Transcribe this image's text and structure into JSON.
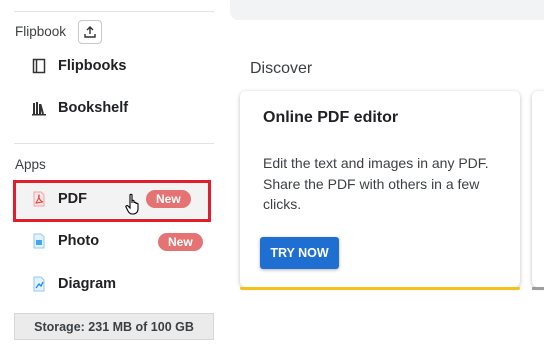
{
  "sidebar": {
    "flipbook_section": "Flipbook",
    "items": [
      {
        "label": "Flipbooks",
        "icon": "flipbook-icon"
      },
      {
        "label": "Bookshelf",
        "icon": "bookshelf-icon"
      }
    ],
    "apps_section": "Apps",
    "apps": [
      {
        "label": "PDF",
        "badge": "New",
        "icon": "pdf-icon"
      },
      {
        "label": "Photo",
        "badge": "New",
        "icon": "photo-icon"
      },
      {
        "label": "Diagram",
        "icon": "diagram-icon"
      }
    ],
    "storage": "Storage: 231 MB of 100 GB"
  },
  "main": {
    "section_title": "Discover",
    "card": {
      "title": "Online PDF editor",
      "text": "Edit the text and images in any PDF. Share the PDF with others in a few clicks.",
      "button": "TRY NOW"
    }
  },
  "colors": {
    "badge": "#e57373",
    "button": "#1f6fd3",
    "card_accent": "#f4c21b",
    "highlight_border": "#e01e2e"
  }
}
